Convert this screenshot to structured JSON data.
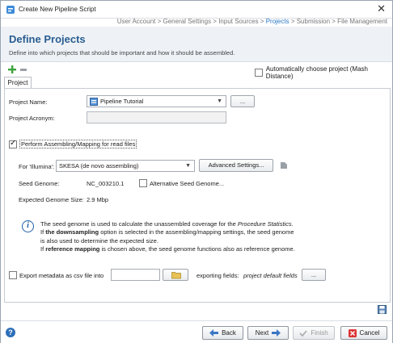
{
  "window": {
    "title": "Create New Pipeline Script",
    "close_glyph": "✕"
  },
  "breadcrumb": {
    "before": "User Account > General Settings > Input Sources > ",
    "active": "Projects",
    "after": " > Submission > File Management"
  },
  "header": {
    "title": "Define Projects",
    "description": "Define into which projects that should be important and how it should be assembled."
  },
  "toolbar": {
    "add_icon": "plus-icon",
    "remove_icon": "minus-icon",
    "auto_choose_label": "Automatically choose project (Mash Distance)",
    "auto_choose_checked": false
  },
  "tabs": [
    {
      "label": "Project"
    }
  ],
  "project": {
    "name_label": "Project Name:",
    "name_value": "Pipeline Tutorial",
    "browse_label": "...",
    "acronym_label": "Project Acronym:",
    "acronym_value": ""
  },
  "assembly": {
    "perform_label": "Perform Assembling/Mapping for read files",
    "perform_checked": true,
    "for_label": "For 'Illumina':",
    "assembler_value": "SKESA (de novo assembling)",
    "advanced_label": "Advanced Settings...",
    "seed_label": "Seed Genome:",
    "seed_value": "NC_003210.1",
    "alt_seed_label": "Alternative Seed Genome...",
    "alt_seed_checked": false,
    "expected_size_label": "Expected Genome Size:",
    "expected_size_value": "2.9 Mbp"
  },
  "info": {
    "line1_a": "The seed genome is used to calculate the unassembled coverage for the ",
    "line1_em": "Procedure Statistics",
    "line1_b": ".",
    "line2_a": "If ",
    "line2_bold": "the downsampling",
    "line2_b": " option is selected in the assembling/mapping settings, the seed genome",
    "line3": "is also used to determine the expected size.",
    "line4_a": "If ",
    "line4_bold": "reference mapping",
    "line4_b": " is chosen above, the seed genome functions also as reference genome."
  },
  "export": {
    "label": "Export metadata as csv file into",
    "checked": false,
    "path_value": "",
    "fields_label": "exporting fields:",
    "fields_value": "project default fields",
    "fields_button": "..."
  },
  "footer": {
    "back_label": "Back",
    "next_label": "Next",
    "finish_label": "Finish",
    "cancel_label": "Cancel"
  },
  "colors": {
    "accent": "#2a5d91",
    "active_crumb": "#2b78c5",
    "header_bg": "#eef2f6"
  }
}
